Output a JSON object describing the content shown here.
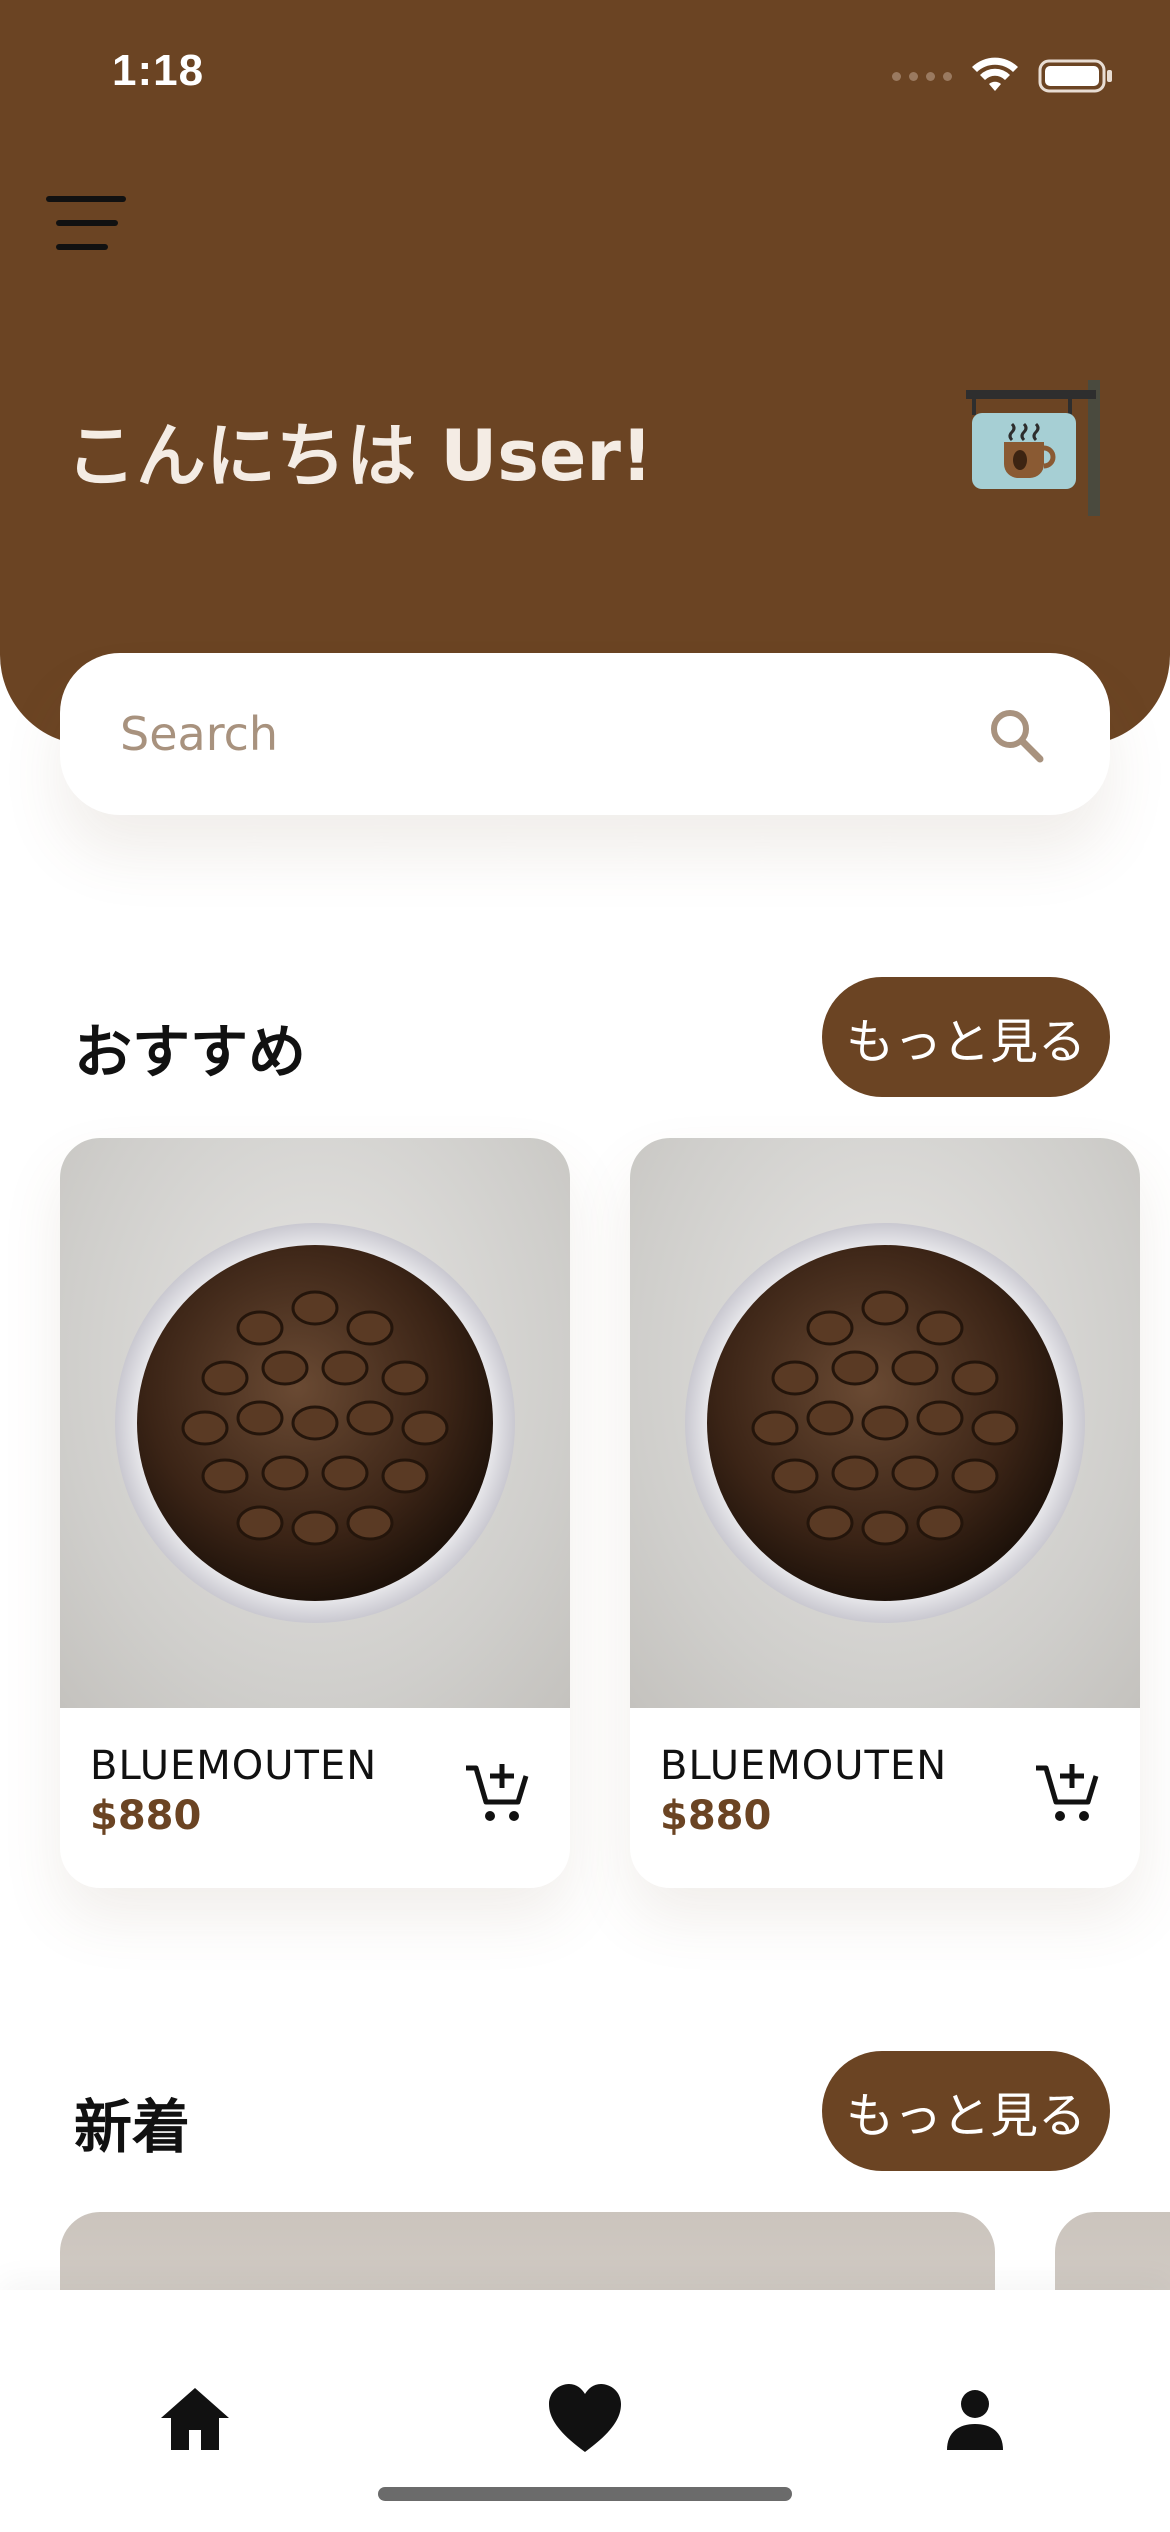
{
  "status_bar": {
    "time": "1:18",
    "wifi_icon": "wifi-icon",
    "battery_icon": "battery-icon"
  },
  "header": {
    "menu_icon": "hamburger-menu-icon",
    "greeting": "こんにちは User!",
    "sign_icon": "cafe-sign-icon",
    "background_color": "#6b4423"
  },
  "search": {
    "placeholder": "Search",
    "icon": "search-icon"
  },
  "recommended": {
    "title": "おすすめ",
    "more_label": "もっと見る",
    "items": [
      {
        "name": "BLUEMOUTEN",
        "price": "$880",
        "image": "coffee-beans-bowl-image",
        "cart_icon": "add-to-cart-icon"
      },
      {
        "name": "BLUEMOUTEN",
        "price": "$880",
        "image": "coffee-beans-bowl-image",
        "cart_icon": "add-to-cart-icon"
      }
    ]
  },
  "new_arrivals": {
    "title": "新着",
    "more_label": "もっと見る"
  },
  "bottom_nav": {
    "items": [
      {
        "icon": "home-icon"
      },
      {
        "icon": "heart-icon"
      },
      {
        "icon": "person-icon"
      }
    ]
  },
  "colors": {
    "brand_brown": "#6b4423",
    "price_brown": "#6b4423",
    "greeting_text": "#f4ece4"
  }
}
